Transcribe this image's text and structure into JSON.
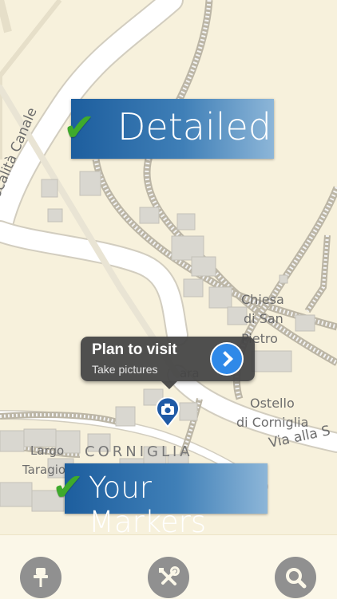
{
  "promo_top": {
    "text": "Detailed",
    "check": "✔"
  },
  "promo_bottom": {
    "text": "Your Markers",
    "check": "✔"
  },
  "map_labels": {
    "road_canale": "Località Canale",
    "chiesa": "Chiesa",
    "di_san": "di San",
    "pietro": "Pietro",
    "ostello": "Ostello",
    "di_corniglia": "di Corniglia",
    "via_alla": "Via alla S",
    "largo": "Largo",
    "taragio": "Taragio",
    "corniglia": "CORNIGLIA",
    "partial_ara": "ara"
  },
  "callout": {
    "title": "Plan to visit",
    "subtitle": "Take pictures"
  },
  "marker": {
    "icon": "camera-icon",
    "color": "#1f5aa6"
  },
  "toolbar": {
    "pin": "pin-icon",
    "tools": "tools-icon",
    "search": "search-icon"
  }
}
